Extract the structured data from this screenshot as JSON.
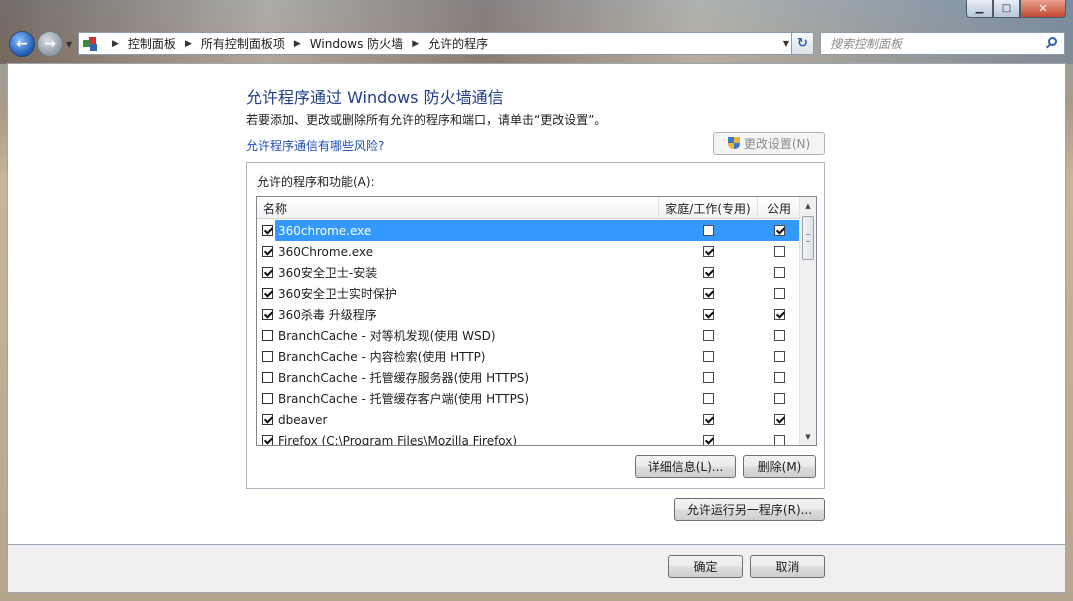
{
  "window": {
    "minimize_glyph": "▁",
    "maximize_glyph": "□",
    "close_glyph": "✕"
  },
  "address_bar": {
    "breadcrumbs": [
      "控制面板",
      "所有控制面板项",
      "Windows 防火墙",
      "允许的程序"
    ],
    "separator": "▶",
    "search_placeholder": "搜索控制面板"
  },
  "page": {
    "title": "允许程序通过 Windows 防火墙通信",
    "description": "若要添加、更改或删除所有允许的程序和端口，请单击“更改设置”。",
    "risk_link": "允许程序通信有哪些风险?",
    "change_settings_label": "更改设置(N)",
    "allowed_label": "允许的程序和功能(A):",
    "columns": {
      "name": "名称",
      "home_work": "家庭/工作(专用)",
      "public": "公用"
    },
    "details_label": "详细信息(L)...",
    "remove_label": "删除(M)",
    "allow_another_label": "允许运行另一程序(R)..."
  },
  "programs": [
    {
      "name": "360chrome.exe",
      "enabled": true,
      "home": false,
      "public": true,
      "selected": true
    },
    {
      "name": "360Chrome.exe",
      "enabled": true,
      "home": true,
      "public": false,
      "selected": false
    },
    {
      "name": "360安全卫士-安装",
      "enabled": true,
      "home": true,
      "public": false,
      "selected": false
    },
    {
      "name": "360安全卫士实时保护",
      "enabled": true,
      "home": true,
      "public": false,
      "selected": false
    },
    {
      "name": "360杀毒 升级程序",
      "enabled": true,
      "home": true,
      "public": true,
      "selected": false
    },
    {
      "name": "BranchCache - 对等机发现(使用 WSD)",
      "enabled": false,
      "home": false,
      "public": false,
      "selected": false
    },
    {
      "name": "BranchCache - 内容检索(使用 HTTP)",
      "enabled": false,
      "home": false,
      "public": false,
      "selected": false
    },
    {
      "name": "BranchCache - 托管缓存服务器(使用 HTTPS)",
      "enabled": false,
      "home": false,
      "public": false,
      "selected": false
    },
    {
      "name": "BranchCache - 托管缓存客户端(使用 HTTPS)",
      "enabled": false,
      "home": false,
      "public": false,
      "selected": false
    },
    {
      "name": "dbeaver",
      "enabled": true,
      "home": true,
      "public": true,
      "selected": false
    },
    {
      "name": "Firefox (C:\\Program Files\\Mozilla Firefox)",
      "enabled": true,
      "home": true,
      "public": false,
      "selected": false
    }
  ],
  "footer": {
    "ok_label": "确定",
    "cancel_label": "取消"
  }
}
